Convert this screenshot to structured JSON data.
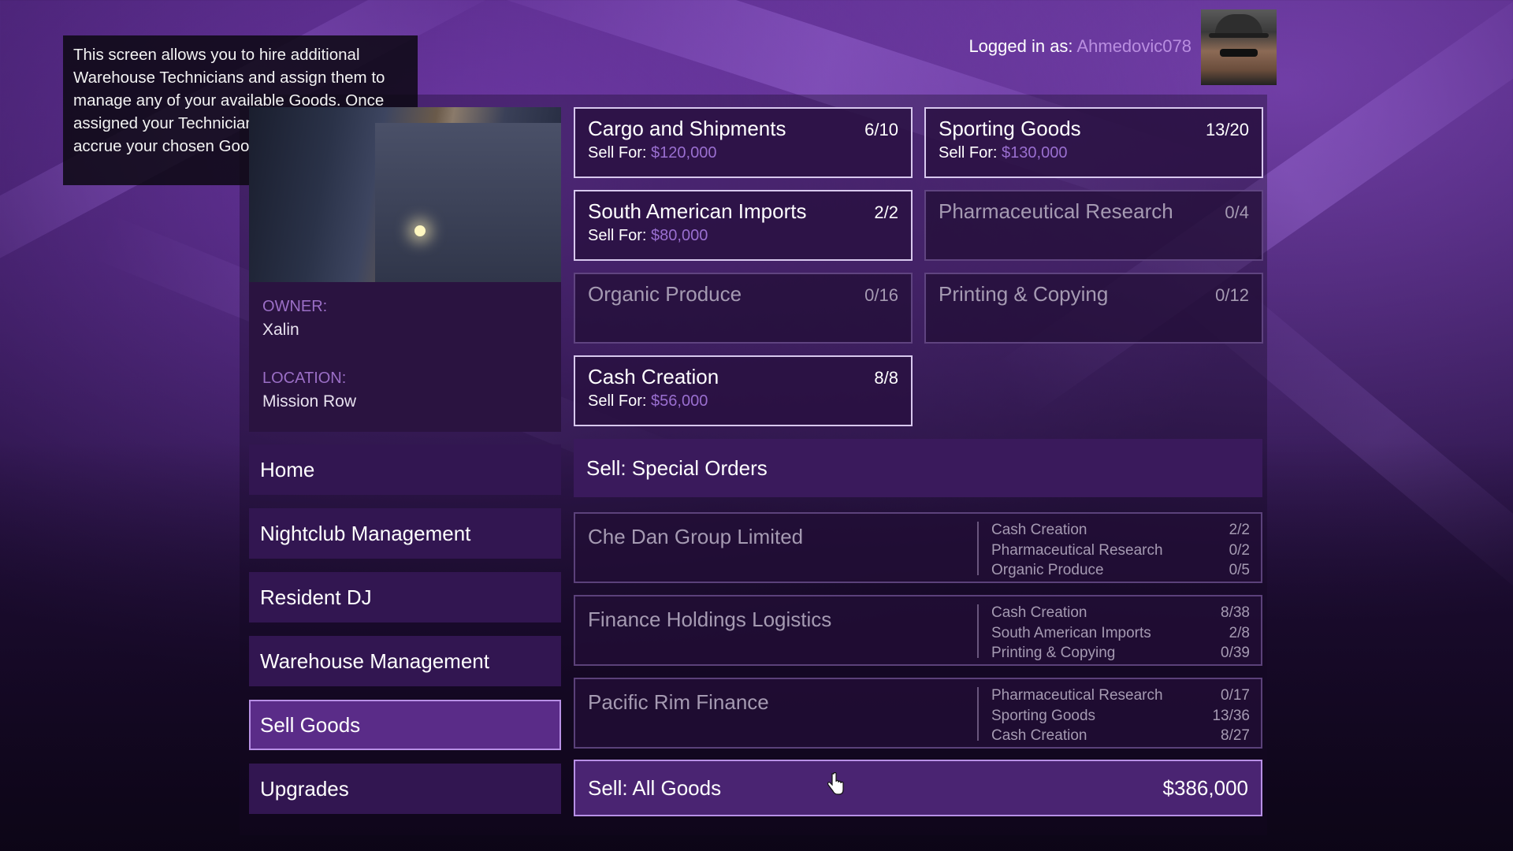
{
  "info_text": "This screen allows you to hire additional Warehouse Technicians and assign them to manage any of your available Goods. Once assigned your Technicians will automatically accrue your chosen Goods over time.",
  "header": {
    "logged_in_label": "Logged in as:",
    "username": "Ahmedovic078"
  },
  "property": {
    "owner_label": "OWNER:",
    "owner": "Xalin",
    "location_label": "LOCATION:",
    "location": "Mission Row"
  },
  "nav": [
    {
      "label": "Home"
    },
    {
      "label": "Nightclub Management"
    },
    {
      "label": "Resident DJ"
    },
    {
      "label": "Warehouse Management"
    },
    {
      "label": "Sell Goods",
      "selected": true
    },
    {
      "label": "Upgrades"
    }
  ],
  "sell_for_label": "Sell For:",
  "goods": [
    {
      "name": "Cargo and Shipments",
      "count": "6/10",
      "price": "$120,000",
      "active": true
    },
    {
      "name": "Sporting Goods",
      "count": "13/20",
      "price": "$130,000",
      "active": true
    },
    {
      "name": "South American Imports",
      "count": "2/2",
      "price": "$80,000",
      "active": true
    },
    {
      "name": "Pharmaceutical Research",
      "count": "0/4",
      "price": "",
      "active": false
    },
    {
      "name": "Organic Produce",
      "count": "0/16",
      "price": "",
      "active": false
    },
    {
      "name": "Printing & Copying",
      "count": "0/12",
      "price": "",
      "active": false
    },
    {
      "name": "Cash Creation",
      "count": "8/8",
      "price": "$56,000",
      "active": true
    }
  ],
  "special_orders_header": "Sell: Special Orders",
  "special_orders": [
    {
      "name": "Che Dan Group Limited",
      "items": [
        {
          "good": "Cash Creation",
          "count": "2/2"
        },
        {
          "good": "Pharmaceutical Research",
          "count": "0/2"
        },
        {
          "good": "Organic Produce",
          "count": "0/5"
        }
      ]
    },
    {
      "name": "Finance Holdings Logistics",
      "items": [
        {
          "good": "Cash Creation",
          "count": "8/38"
        },
        {
          "good": "South American Imports",
          "count": "2/8"
        },
        {
          "good": "Printing & Copying",
          "count": "0/39"
        }
      ]
    },
    {
      "name": "Pacific Rim Finance",
      "items": [
        {
          "good": "Pharmaceutical Research",
          "count": "0/17"
        },
        {
          "good": "Sporting Goods",
          "count": "13/36"
        },
        {
          "good": "Cash Creation",
          "count": "8/27"
        }
      ]
    }
  ],
  "sell_all": {
    "label": "Sell: All Goods",
    "total": "$386,000"
  },
  "colors": {
    "accent": "#5a2c88",
    "highlight": "#9a6fd0",
    "panel": "#321651"
  }
}
